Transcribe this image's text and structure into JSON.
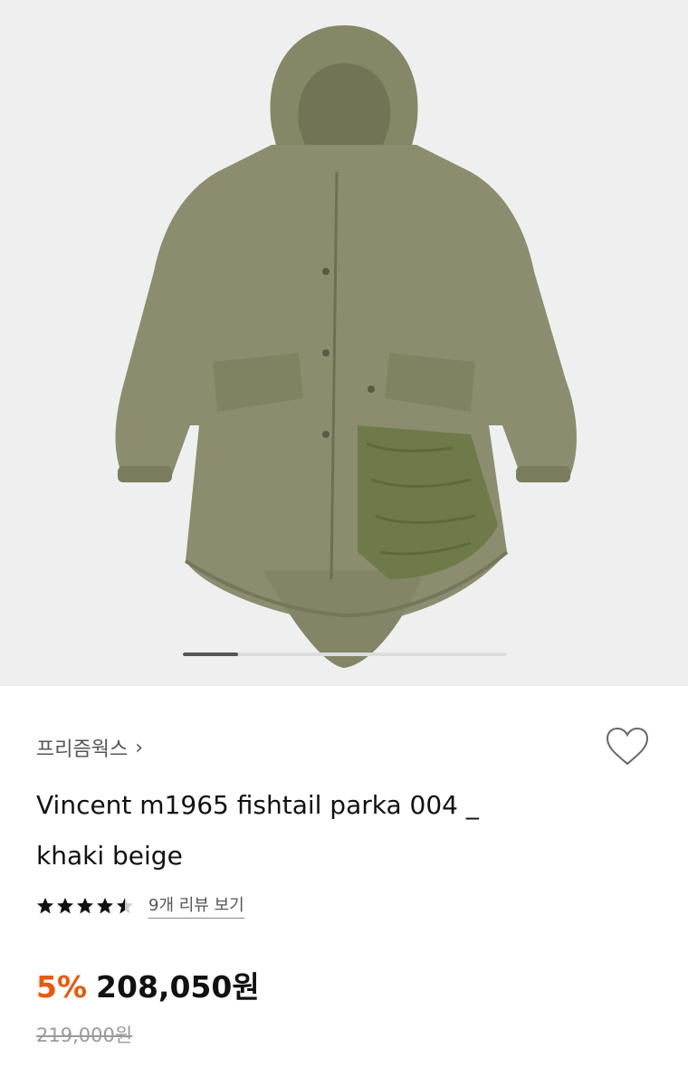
{
  "gallery": {
    "image_alt": "khaki fishtail parka with quilted liner",
    "slide_progress": 0.17
  },
  "product": {
    "brand": "프리즘웍스",
    "brand_chevron": "›",
    "title_line1": "Vincent m1965 fishtail parka 004 _",
    "title_line2": "khaki beige",
    "rating": 4.5,
    "review_link": "9개 리뷰 보기",
    "discount": "5%",
    "price": "208,050원",
    "original_price": "219,000원"
  },
  "icons": {
    "wishlist": "heart-outline-icon",
    "brand_link": "chevron-right-icon",
    "star": "star-icon"
  },
  "colors": {
    "discount": "#e8590c",
    "hero_bg": "#efefef",
    "parka": "#8c8d6e"
  }
}
